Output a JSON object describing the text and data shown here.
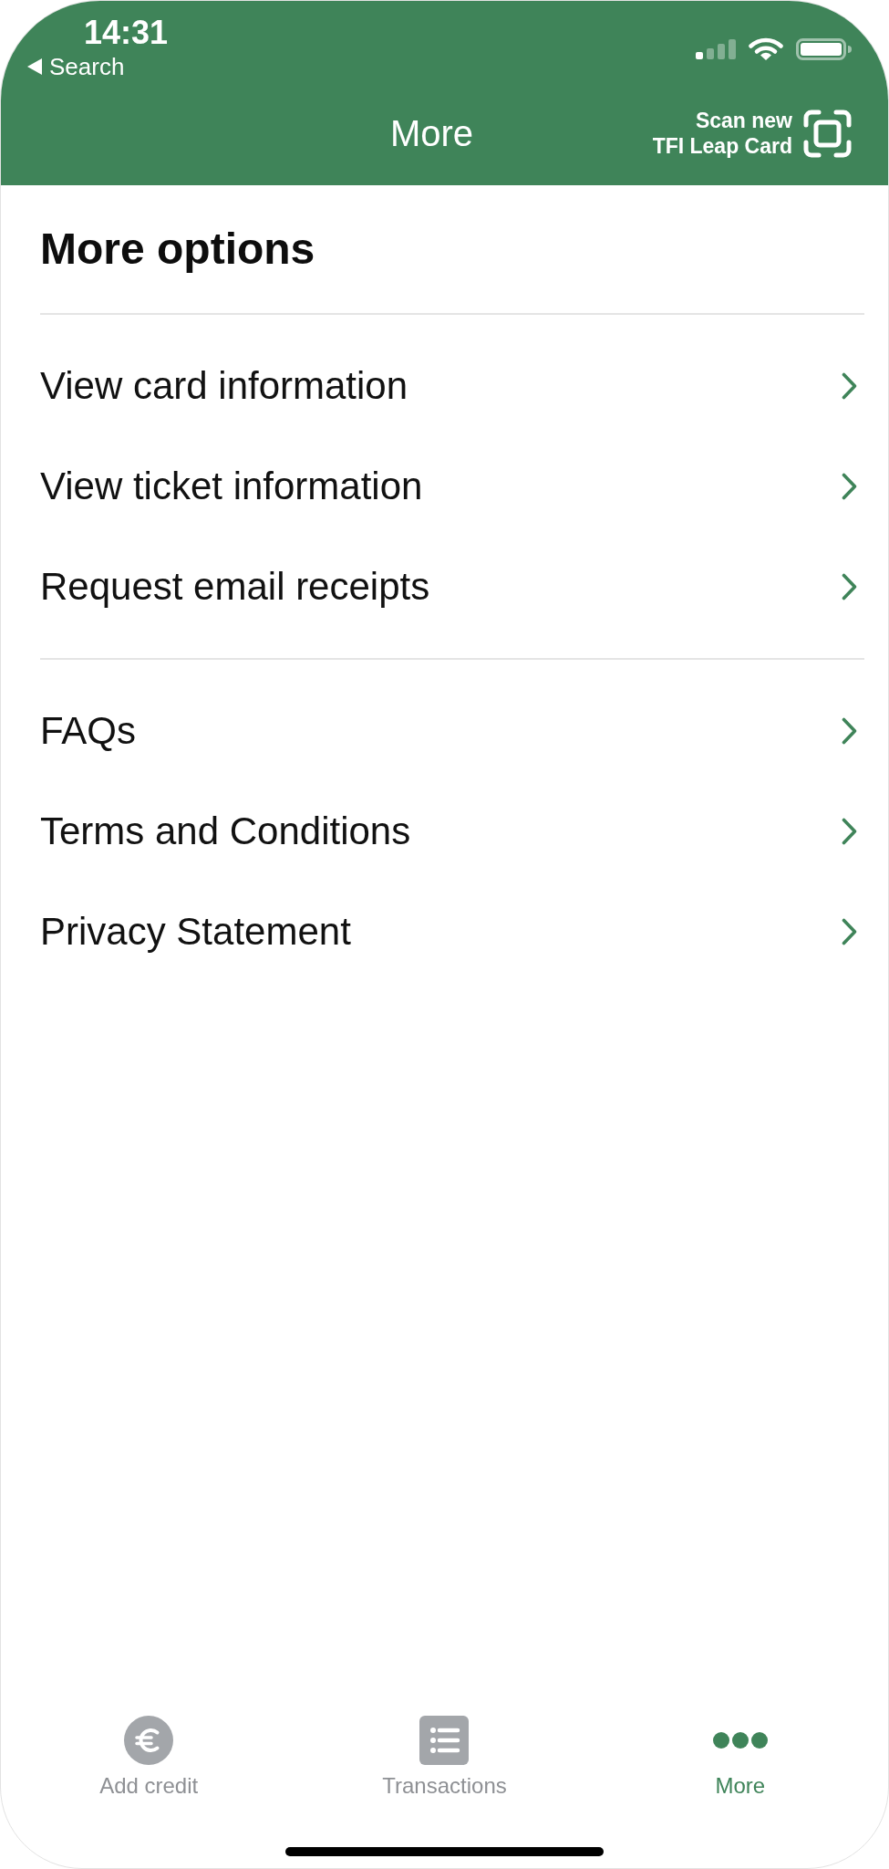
{
  "status_bar": {
    "time": "14:31",
    "back_label": "Search"
  },
  "nav_bar": {
    "title": "More",
    "scan_button": {
      "lines": [
        "Scan new",
        "TFI Leap Card"
      ]
    }
  },
  "section_title": "More options",
  "groups": [
    {
      "items": [
        {
          "label": "View card information"
        },
        {
          "label": "View ticket information"
        },
        {
          "label": "Request email receipts"
        }
      ]
    },
    {
      "items": [
        {
          "label": "FAQs"
        },
        {
          "label": "Terms and Conditions"
        },
        {
          "label": "Privacy Statement"
        }
      ]
    }
  ],
  "tab_bar": [
    {
      "kind": "euro",
      "label": "Add credit",
      "selected": false
    },
    {
      "kind": "list",
      "label": "Transactions",
      "selected": false
    },
    {
      "kind": "more",
      "label": "More",
      "selected": true
    }
  ]
}
